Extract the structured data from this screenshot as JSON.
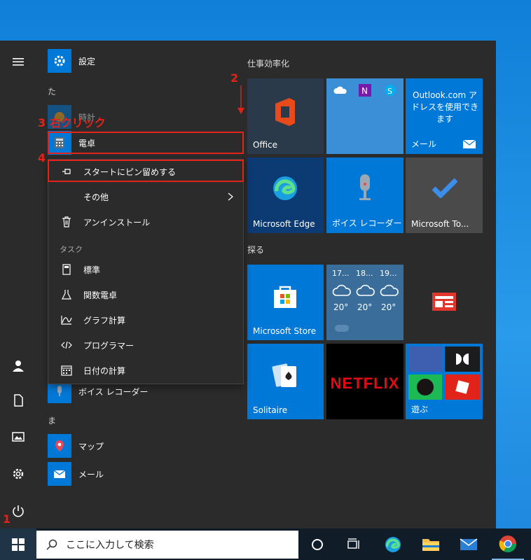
{
  "apps": {
    "settings": "設定",
    "letter_ta": "た",
    "clock_hint": "時計",
    "calculator": "電卓",
    "voice_recorder": "ボイス レコーダー",
    "letter_ma": "ま",
    "maps": "マップ",
    "mail": "メール"
  },
  "context_menu": {
    "pin_to_start": "スタートにピン留めする",
    "more": "その他",
    "uninstall": "アンインストール",
    "tasks_header": "タスク",
    "standard": "標準",
    "scientific": "関数電卓",
    "graphing": "グラフ計算",
    "programmer": "プログラマー",
    "date_calc": "日付の計算"
  },
  "sections": {
    "productivity": "仕事効率化",
    "explore": "探る"
  },
  "tiles": {
    "office": "Office",
    "outlook_text": "Outlook.com アドレスを使用できます",
    "mail": "メール",
    "edge": "Microsoft Edge",
    "voice_recorder": "ボイス レコーダー",
    "todo": "Microsoft To...",
    "store": "Microsoft Store",
    "weather_times": [
      "17...",
      "18...",
      "19..."
    ],
    "weather_temps": [
      "20°",
      "20°",
      "20°"
    ],
    "solitaire": "Solitaire",
    "netflix": "NETFLIX",
    "play": "遊ぶ"
  },
  "annotations": {
    "step1": "1",
    "step2": "2",
    "step3": "3 右クリック",
    "step4": "4"
  },
  "taskbar": {
    "search_placeholder": "ここに入力して検索"
  },
  "colors": {
    "accent": "#0078d7",
    "annotation": "#e2231a",
    "start_bg": "#2b2b2b",
    "taskbar_bg": "#101c28"
  }
}
